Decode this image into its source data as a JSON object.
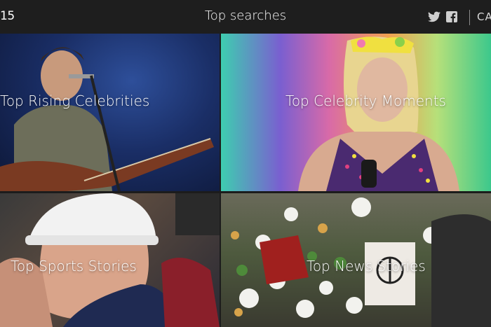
{
  "header": {
    "year_fragment": "15",
    "title": "Top searches",
    "right_fragment": "CA",
    "icons": [
      "twitter-icon",
      "facebook-icon"
    ]
  },
  "tiles": [
    {
      "label": "Top Rising Celebrities"
    },
    {
      "label": "Top Celebrity Moments"
    },
    {
      "label": "Top Sports Stories"
    },
    {
      "label": "Top News Stories"
    }
  ],
  "colors": {
    "header_bg": "#1e1e1e",
    "text": "#ffffff"
  }
}
